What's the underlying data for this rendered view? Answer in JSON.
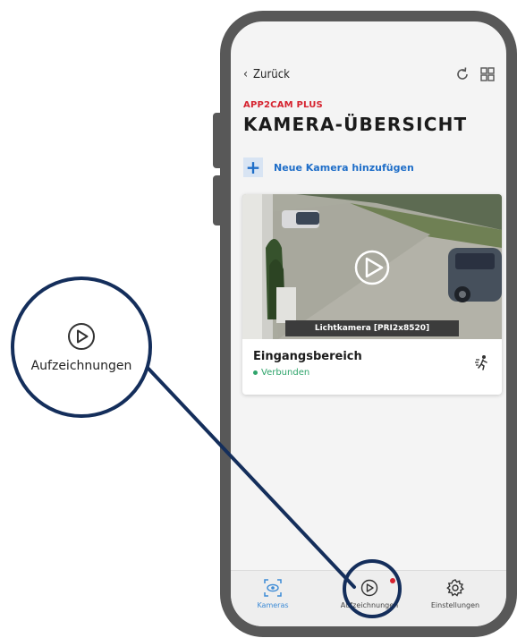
{
  "topbar": {
    "back_label": "Zurück",
    "icons": [
      "refresh-icon",
      "grid-view-icon"
    ]
  },
  "header": {
    "brand": "APP2CAM PLUS",
    "title": "KAMERA-ÜBERSICHT"
  },
  "actions": {
    "add_camera_label": "Neue Kamera hinzufügen",
    "add_icon": "plus-icon"
  },
  "camera": {
    "overlay_label": "Lichtkamera [PRI2x8520]",
    "name": "Eingangsbereich",
    "status": "Verbunden",
    "play_icon": "play-icon",
    "motion_icon": "motion-sensor-icon"
  },
  "bottom_nav": {
    "items": [
      {
        "label": "Kameras",
        "icon": "camera-icon",
        "active": true
      },
      {
        "label": "Aufzeichnungen",
        "icon": "play-icon",
        "badge": true
      },
      {
        "label": "Einstellungen",
        "icon": "gear-icon"
      }
    ]
  },
  "callout": {
    "label": "Aufzeichnungen",
    "icon": "play-icon"
  },
  "colors": {
    "accent_blue": "#1f6ec8",
    "brand_red": "#d6232f",
    "status_green": "#2fa46b",
    "callout_navy": "#142e5b",
    "phone_frame": "#585858"
  }
}
